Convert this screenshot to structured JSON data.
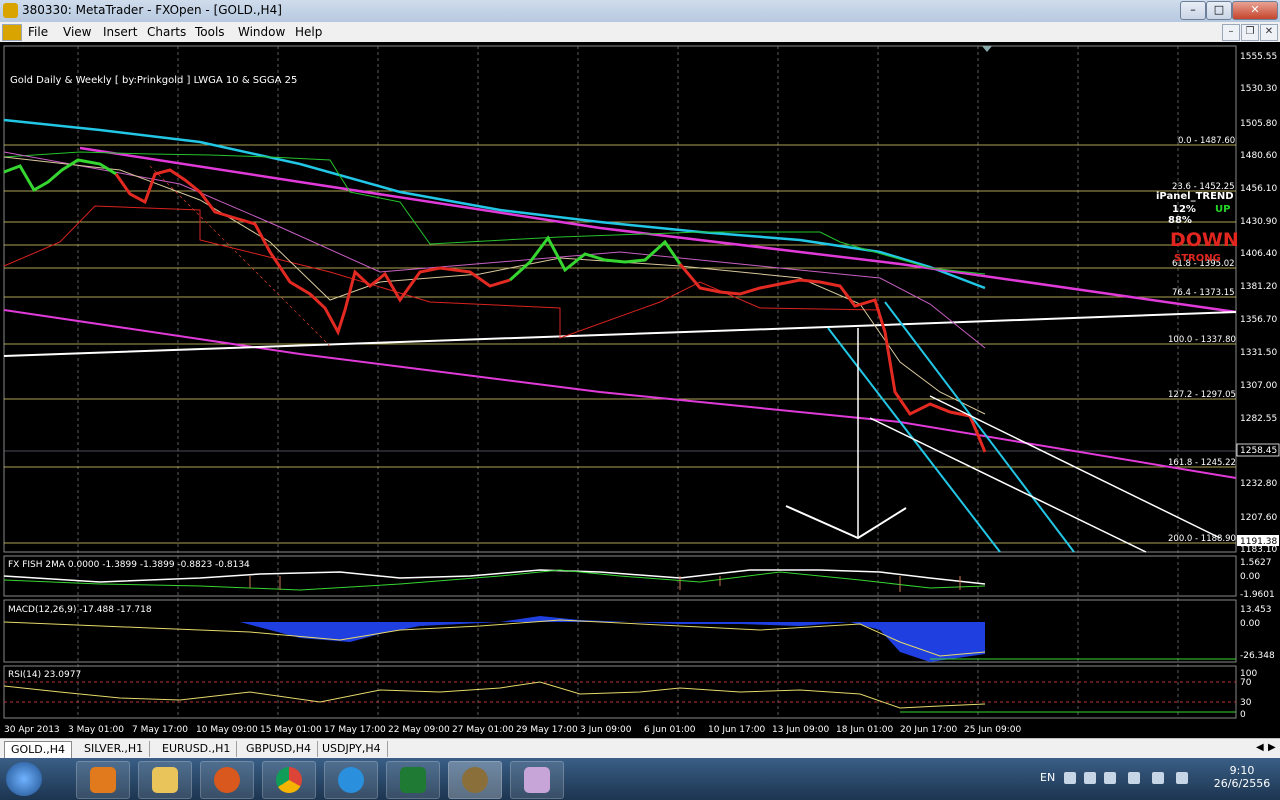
{
  "window": {
    "title": "380330: MetaTrader - FXOpen - [GOLD.,H4]"
  },
  "menu": [
    "File",
    "View",
    "Insert",
    "Charts",
    "Tools",
    "Window",
    "Help"
  ],
  "window_buttons": {
    "minimize": "–",
    "maximize": "□",
    "close": "✕"
  },
  "mdi_buttons": {
    "minimize": "–",
    "restore": "❐",
    "close": "✕"
  },
  "chart": {
    "header": "Gold Daily & Weekly [ by:Prinkgold ] LWGA 10 & SGGA 25",
    "price_labels": [
      "1555.55",
      "1530.30",
      "1505.80",
      "1480.60",
      "1456.10",
      "1430.90",
      "1406.40",
      "1381.20",
      "1356.70",
      "1331.50",
      "1307.00",
      "1282.55",
      "1258.45",
      "1232.80",
      "1207.60",
      "1191.38",
      "1183.10"
    ],
    "current_price": "1258.45",
    "fibo": [
      {
        "label": "0.0 - 1487.60"
      },
      {
        "label": "23.6 - 1452.25"
      },
      {
        "label": "61.8 - 1395.02"
      },
      {
        "label": "76.4 - 1373.15"
      },
      {
        "label": "100.0 - 1337.80"
      },
      {
        "label": "127.2 - 1297.05"
      },
      {
        "label": "161.8 - 1245.22"
      },
      {
        "label": "200.0 - 1188.90"
      }
    ],
    "ipanel": {
      "title": "iPanel_TREND",
      "pct1": "12%",
      "pct1_label": "UP",
      "pct2": "88%",
      "trend": "DOWN",
      "strength": "STRONG"
    },
    "dates": [
      "30 Apr 2013",
      "3 May 01:00",
      "7 May 17:00",
      "10 May 09:00",
      "15 May 01:00",
      "17 May 17:00",
      "22 May 09:00",
      "27 May 01:00",
      "29 May 17:00",
      "3 Jun 09:00",
      "6 Jun 01:00",
      "10 Jun 17:00",
      "13 Jun 09:00",
      "18 Jun 01:00",
      "20 Jun 17:00",
      "25 Jun 09:00"
    ]
  },
  "indicators": {
    "fish": {
      "label": "FX FISH 2MA 0.0000 -1.3899 -1.3899 -0.8823 -0.8134",
      "scale": [
        "1.5627",
        "0.00",
        "-1.9601"
      ]
    },
    "macd": {
      "label": "MACD(12,26,9) -17.488 -17.718",
      "scale": [
        "13.453",
        "0.00",
        "-26.348"
      ]
    },
    "rsi": {
      "label": "RSI(14) 23.0977",
      "scale": [
        "100",
        "70",
        "30",
        "0"
      ]
    }
  },
  "tabs": [
    "GOLD.,H4",
    "SILVER.,H1",
    "EURUSD.,H1",
    "GBPUSD,H4",
    "USDJPY,H4"
  ],
  "taskbar": {
    "lang": "EN",
    "time": "9:10",
    "date": "26/6/2556"
  }
}
